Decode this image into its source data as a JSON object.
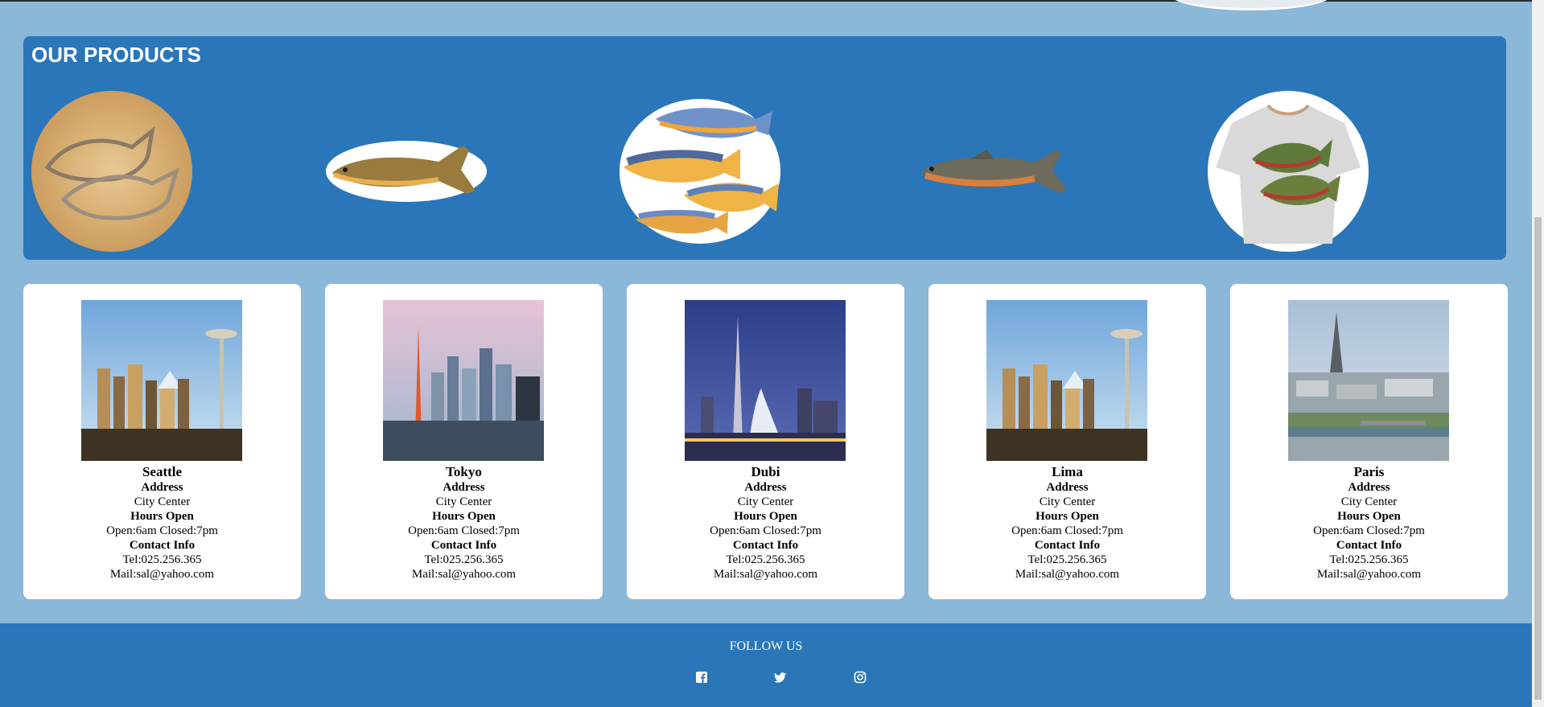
{
  "products": {
    "title": "OUR PRODUCTS",
    "items": [
      {
        "name": "salmon-cookie-cutter-image"
      },
      {
        "name": "trout-fish-image"
      },
      {
        "name": "colorful-fish-group-image"
      },
      {
        "name": "salmon-fish-image"
      },
      {
        "name": "salmon-tshirt-image"
      }
    ]
  },
  "locations": [
    {
      "city": "Seattle",
      "address_label": "Address",
      "address": "City Center",
      "hours_label": "Hours Open",
      "hours": "Open:6am Closed:7pm",
      "contact_label": "Contact Info",
      "tel": "Tel:025.256.365",
      "mail": "Mail:sal@yahoo.com"
    },
    {
      "city": "Tokyo",
      "address_label": "Address",
      "address": "City Center",
      "hours_label": "Hours Open",
      "hours": "Open:6am Closed:7pm",
      "contact_label": "Contact Info",
      "tel": "Tel:025.256.365",
      "mail": "Mail:sal@yahoo.com"
    },
    {
      "city": "Dubi",
      "address_label": "Address",
      "address": "City Center",
      "hours_label": "Hours Open",
      "hours": "Open:6am Closed:7pm",
      "contact_label": "Contact Info",
      "tel": "Tel:025.256.365",
      "mail": "Mail:sal@yahoo.com"
    },
    {
      "city": "Lima",
      "address_label": "Address",
      "address": "City Center",
      "hours_label": "Hours Open",
      "hours": "Open:6am Closed:7pm",
      "contact_label": "Contact Info",
      "tel": "Tel:025.256.365",
      "mail": "Mail:sal@yahoo.com"
    },
    {
      "city": "Paris",
      "address_label": "Address",
      "address": "City Center",
      "hours_label": "Hours Open",
      "hours": "Open:6am Closed:7pm",
      "contact_label": "Contact Info",
      "tel": "Tel:025.256.365",
      "mail": "Mail:sal@yahoo.com"
    }
  ],
  "footer": {
    "follow_label": "FOLLOW US",
    "icons": [
      "facebook-icon",
      "twitter-icon",
      "instagram-icon"
    ]
  },
  "colors": {
    "page_background": "#8bb7d9",
    "panel_blue": "#2a76b8",
    "card_background": "#ffffff"
  }
}
